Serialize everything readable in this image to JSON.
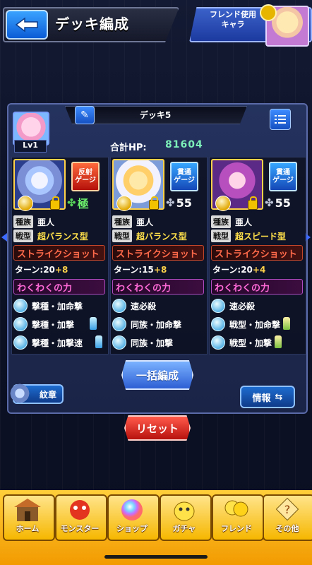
{
  "header": {
    "title": "デッキ編成",
    "friend_button_label_line1": "フレンド使用",
    "friend_button_label_line2": "キャラ"
  },
  "deck": {
    "name": "デッキ5",
    "level": "Lv1",
    "hp_label": "合計HP:",
    "hp_value": "81604"
  },
  "cards": [
    {
      "badge": "反射\nゲージ",
      "badge_type": "red",
      "luck": "極",
      "luck_type": "kanji",
      "race_tag": "種族",
      "race": "亜人",
      "style_tag": "戦型",
      "style": "超バランス型",
      "strike_shot": "ストライクショット",
      "turn": "ターン:20",
      "turn_plus": "+8",
      "waku": "わくわくの力",
      "abilities": [
        "撃種・加命撃",
        "撃種・加撃",
        "撃種・加撃速"
      ]
    },
    {
      "badge": "貫通\nゲージ",
      "badge_type": "blue",
      "luck": "55",
      "luck_type": "number",
      "race_tag": "種族",
      "race": "亜人",
      "style_tag": "戦型",
      "style": "超バランス型",
      "strike_shot": "ストライクショット",
      "turn": "ターン:15",
      "turn_plus": "+8",
      "waku": "わくわくの力",
      "abilities": [
        "速必殺",
        "同族・加命撃",
        "同族・加撃"
      ]
    },
    {
      "badge": "貫通\nゲージ",
      "badge_type": "blue",
      "luck": "55",
      "luck_type": "number",
      "race_tag": "種族",
      "race": "亜人",
      "style_tag": "戦型",
      "style": "超スピード型",
      "strike_shot": "ストライクショット",
      "turn": "ターン:20",
      "turn_plus": "+4",
      "waku": "わくわくの力",
      "abilities": [
        "速必殺",
        "戦型・加命撃",
        "戦型・加撃"
      ]
    }
  ],
  "buttons": {
    "bulk_edit": "一括編成",
    "emblem": "紋章",
    "info": "情報",
    "reset": "リセット"
  },
  "nav": [
    {
      "label": "ホーム",
      "icon": "home-icon"
    },
    {
      "label": "モンスター",
      "icon": "monster-icon"
    },
    {
      "label": "ショップ",
      "icon": "shop-orb-icon"
    },
    {
      "label": "ガチャ",
      "icon": "gacha-icon"
    },
    {
      "label": "フレンド",
      "icon": "friend-balloon-icon"
    },
    {
      "label": "その他",
      "icon": "other-icon"
    }
  ],
  "colors": {
    "hp_value": "#7cf0b8",
    "turn_plus": "#ffd24a",
    "strike_text": "#ff6a4a",
    "waku_text": "#ff6ad8",
    "nav_bg": "#f2a600"
  }
}
